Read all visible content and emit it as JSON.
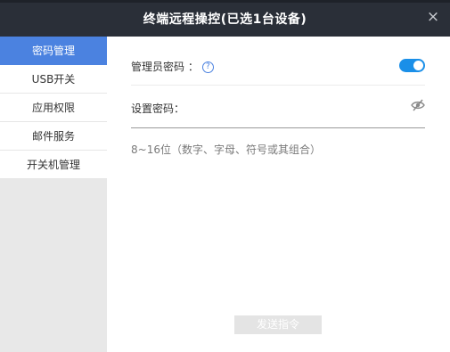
{
  "window": {
    "title": "终端远程操控(已选1台设备)",
    "close_symbol": "×"
  },
  "sidebar": {
    "items": [
      {
        "label": "密码管理",
        "active": true
      },
      {
        "label": "USB开关",
        "active": false
      },
      {
        "label": "应用权限",
        "active": false
      },
      {
        "label": "邮件服务",
        "active": false
      },
      {
        "label": "开关机管理",
        "active": false
      }
    ]
  },
  "content": {
    "admin_label": "管理员密码 ：",
    "help_symbol": "?",
    "toggle_on": true,
    "password_label": "设置密码：",
    "password_value": "",
    "hint": "8~16位（数字、字母、符号或其组合）",
    "send_button": "发送指令"
  },
  "colors": {
    "titlebar": "#2a2f38",
    "accent": "#4b82e0",
    "toggle": "#1a8fe8",
    "sidebar_bg": "#e8e8e8",
    "button_disabled": "#e4e4e4"
  }
}
